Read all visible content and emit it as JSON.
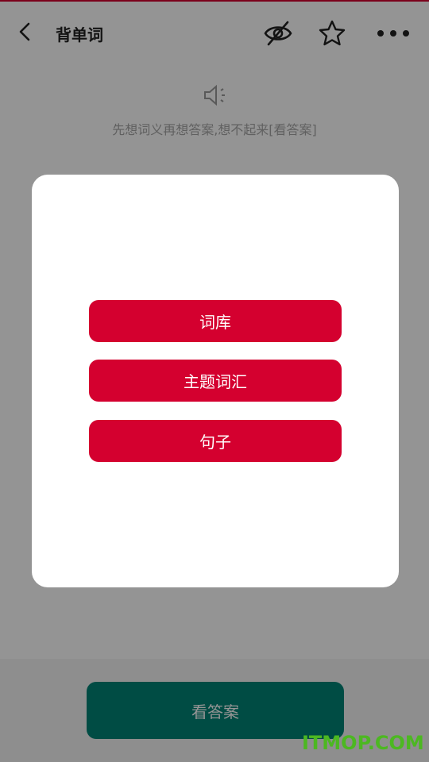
{
  "header": {
    "title": "背单词",
    "icons": [
      "back-arrow-icon",
      "hide-eye-icon",
      "star-icon",
      "more-icon"
    ]
  },
  "content": {
    "hint": "先想词义再想答案,想不起来[看答案]"
  },
  "bottom": {
    "answer_label": "看答案"
  },
  "dialog": {
    "options": [
      {
        "label": "词库"
      },
      {
        "label": "主题词汇"
      },
      {
        "label": "句子"
      }
    ]
  },
  "watermark": "ITMOP.COM",
  "colors": {
    "accent_red": "#d4002f",
    "teal": "#008375",
    "watermark_green": "#4cb821"
  }
}
